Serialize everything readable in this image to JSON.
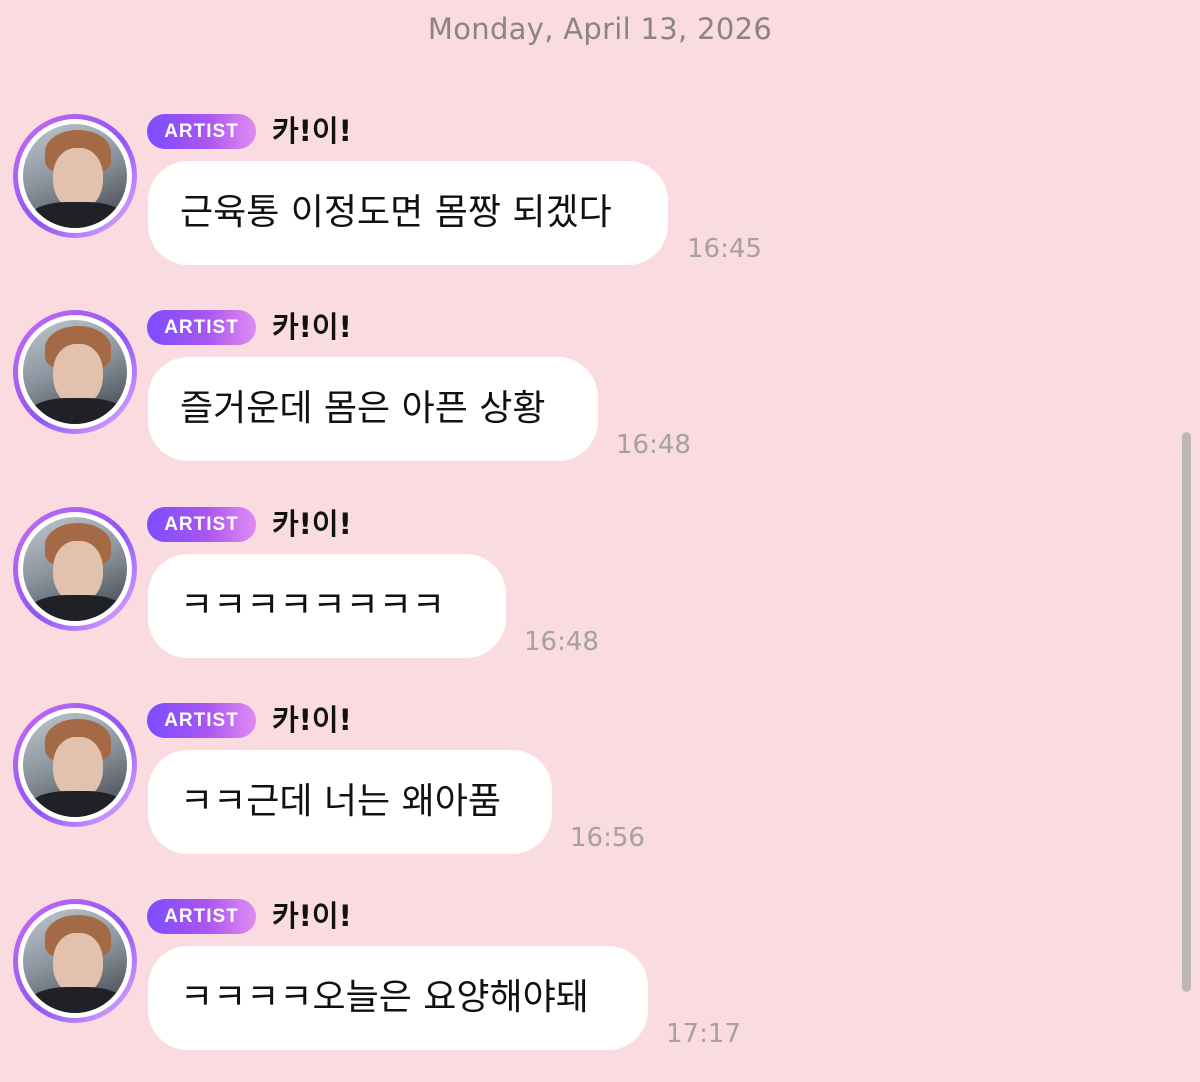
{
  "date_header": "Monday, April 13, 2026",
  "badge_label": "ARTIST",
  "sender_name": "카!이!",
  "messages": [
    {
      "text": "근육통 이정도면 몸짱 되겠다",
      "time": "16:45"
    },
    {
      "text": "즐거운데 몸은 아픈 상황",
      "time": "16:48"
    },
    {
      "text": "ㅋㅋㅋㅋㅋㅋㅋㅋ",
      "time": "16:48"
    },
    {
      "text": "ㅋㅋ근데 너는 왜아품",
      "time": "16:56"
    },
    {
      "text": "ㅋㅋㅋㅋ오늘은 요양해야돼",
      "time": "17:17"
    }
  ]
}
